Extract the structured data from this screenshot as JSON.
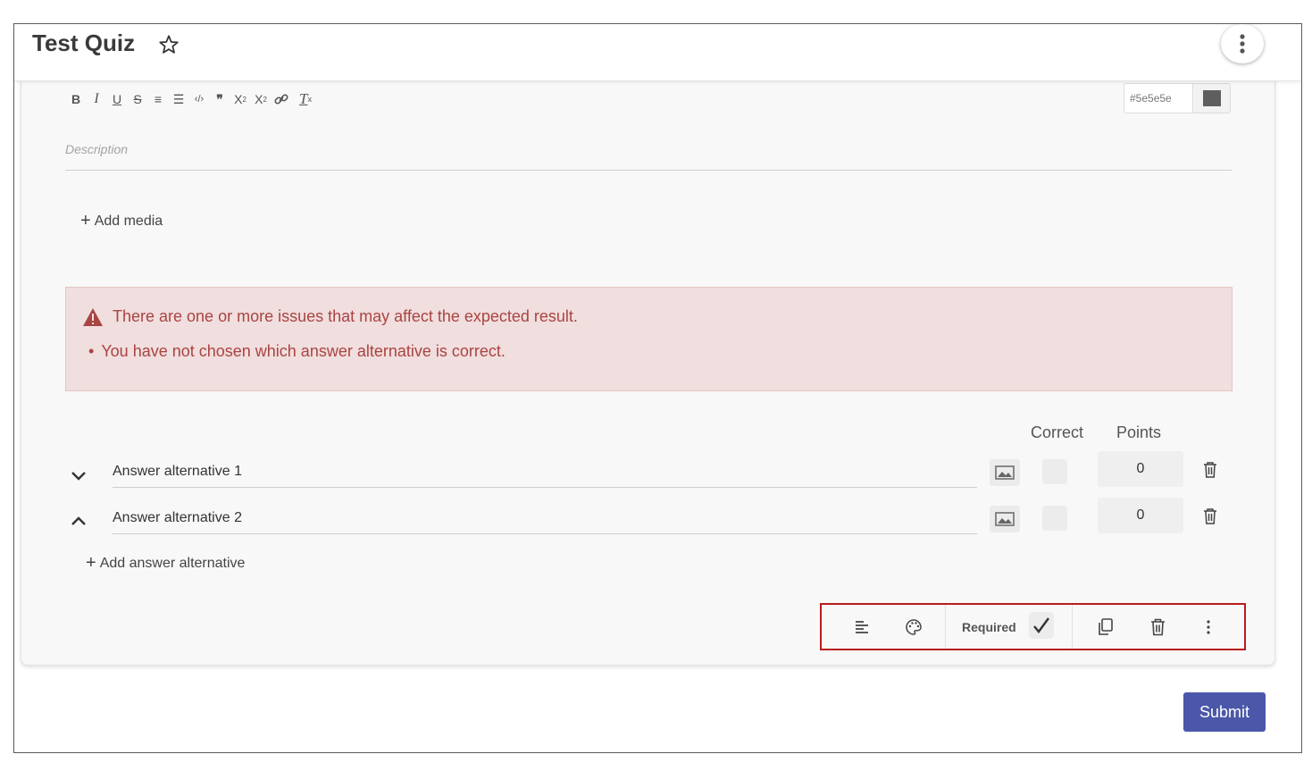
{
  "header": {
    "title": "Test Quiz",
    "favorite_icon": "star-outline-icon",
    "menu_icon": "more-vertical-icon"
  },
  "editor": {
    "toolbar": {
      "bold": "B",
      "italic": "I",
      "underline": "U",
      "strike": "S",
      "ordered_list": "≡",
      "bullet_list": "☰",
      "code": "‹/›",
      "blockquote": "❞",
      "subscript_base": "X",
      "subscript_mark": "2",
      "superscript_base": "X",
      "superscript_mark": "2",
      "link": "⛓",
      "clear_format_base": "T",
      "clear_format_mark": "x"
    },
    "color_value": "#5e5e5e",
    "description_placeholder": "Description"
  },
  "add_media_label": "Add media",
  "alert": {
    "heading": "There are one or more issues that may affect the expected result.",
    "items": [
      "You have not chosen which answer alternative is correct."
    ],
    "color": "#a94442"
  },
  "answers": {
    "col_correct": "Correct",
    "col_points": "Points",
    "rows": [
      {
        "label": "Answer alternative 1",
        "points": "0",
        "correct": false
      },
      {
        "label": "Answer alternative 2",
        "points": "0",
        "correct": false
      }
    ],
    "add_label": "Add answer alternative"
  },
  "question_toolbar": {
    "align_icon": "align-left-icon",
    "palette_icon": "palette-icon",
    "required_label": "Required",
    "required_checked": true,
    "duplicate_icon": "copy-icon",
    "delete_icon": "trash-icon",
    "more_icon": "more-vertical-icon"
  },
  "submit_label": "Submit",
  "colors": {
    "accent": "#4b57a8",
    "highlight_border": "#b71c1c",
    "alert_bg": "#f1dede"
  }
}
